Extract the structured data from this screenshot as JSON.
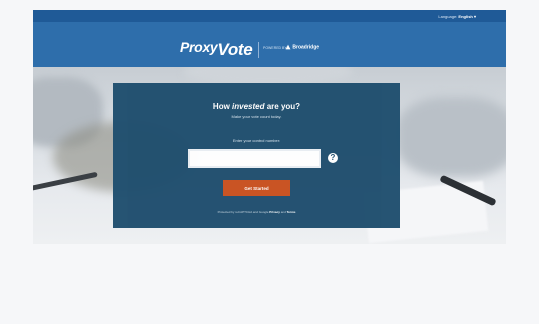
{
  "topbar": {
    "language_label": "Language:",
    "language_value": "English ▾"
  },
  "header": {
    "logo_prefix": "Proxy",
    "logo_suffix": "Vote",
    "powered_by": "POWERED BY",
    "brand": "Broadridge"
  },
  "card": {
    "headline_pre": "How ",
    "headline_em": "invested",
    "headline_post": " are you?",
    "subheading": "Make your vote count today.",
    "input_label": "Enter your control number:",
    "input_value": "",
    "help_icon": "?",
    "button": "Get Started",
    "footer_text": "Protected by reCAPTCHA and Google ",
    "footer_link_privacy": "Privacy",
    "footer_and": " and ",
    "footer_link_terms": "Terms",
    "icon_names": [
      "question-circle-icon",
      "broadridge-logo-icon"
    ]
  },
  "colors": {
    "topbar": "#1f5a97",
    "header": "#2e6eab",
    "card": "#1f4e6e",
    "button": "#c9501e"
  }
}
